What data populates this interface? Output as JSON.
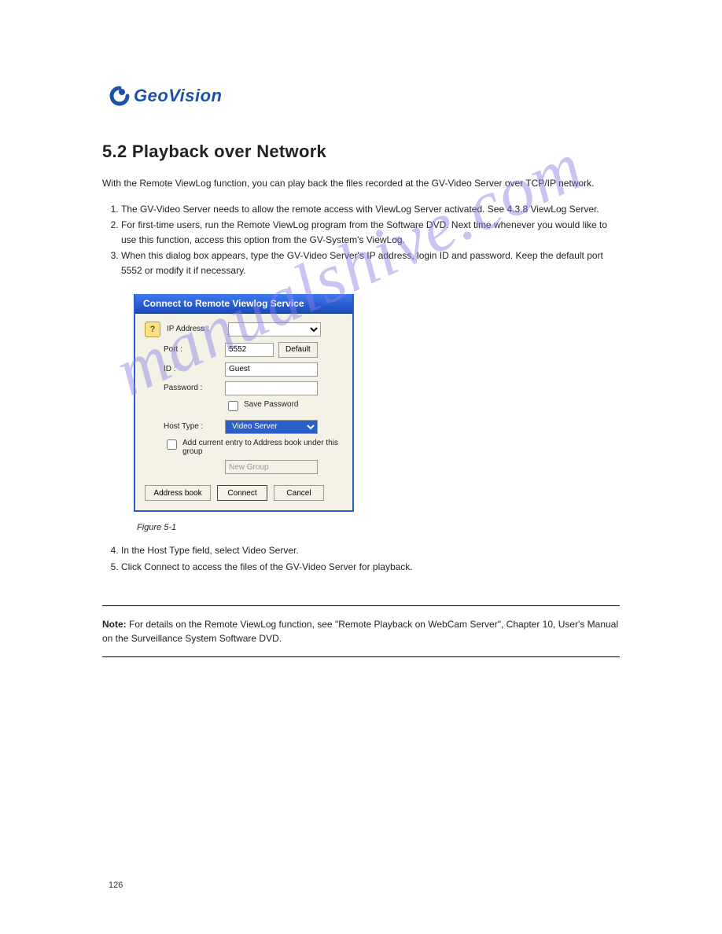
{
  "logo": {
    "brand_part1": "Geo",
    "brand_part2": "Vision"
  },
  "watermark": "manualshive.com",
  "heading": "5.2 Playback over Network",
  "intro": "With the Remote ViewLog function, you can play back the files recorded at the GV-Video Server over TCP/IP network.",
  "steps": [
    "The GV-Video Server needs to allow the remote access with ViewLog Server activated. See 4.3.8 ViewLog Server.",
    "For first-time users, run the Remote ViewLog program from the Software DVD. Next time whenever you would like to use this function, access this option from the GV-System's ViewLog.",
    "When this dialog box appears, type the GV-Video Server's IP address, login ID and password. Keep the default port 5552 or modify it if necessary."
  ],
  "dialog": {
    "title": "Connect to Remote Viewlog Service",
    "labels": {
      "ip": "IP Address :",
      "port": "Port :",
      "id": "ID :",
      "password": "Password :",
      "host_type": "Host Type :"
    },
    "values": {
      "ip": "",
      "port": "5552",
      "id": "Guest",
      "password": "",
      "host_type": "Video Server",
      "new_group": "New Group"
    },
    "buttons": {
      "default": "Default",
      "address_book": "Address book",
      "connect": "Connect",
      "cancel": "Cancel"
    },
    "check_save_pw": "Save Password",
    "check_add_entry": "Add current entry to Address book under this group"
  },
  "caption": "Figure 5-1",
  "steps_after": [
    "In the Host Type field, select Video Server.",
    "Click Connect to access the files of the GV-Video Server for playback."
  ],
  "note": {
    "label": "Note:",
    "text": " For details on the Remote ViewLog function, see \"Remote Playback on WebCam Server\", Chapter 10, User's Manual on the Surveillance System Software DVD."
  },
  "page_number": "126"
}
